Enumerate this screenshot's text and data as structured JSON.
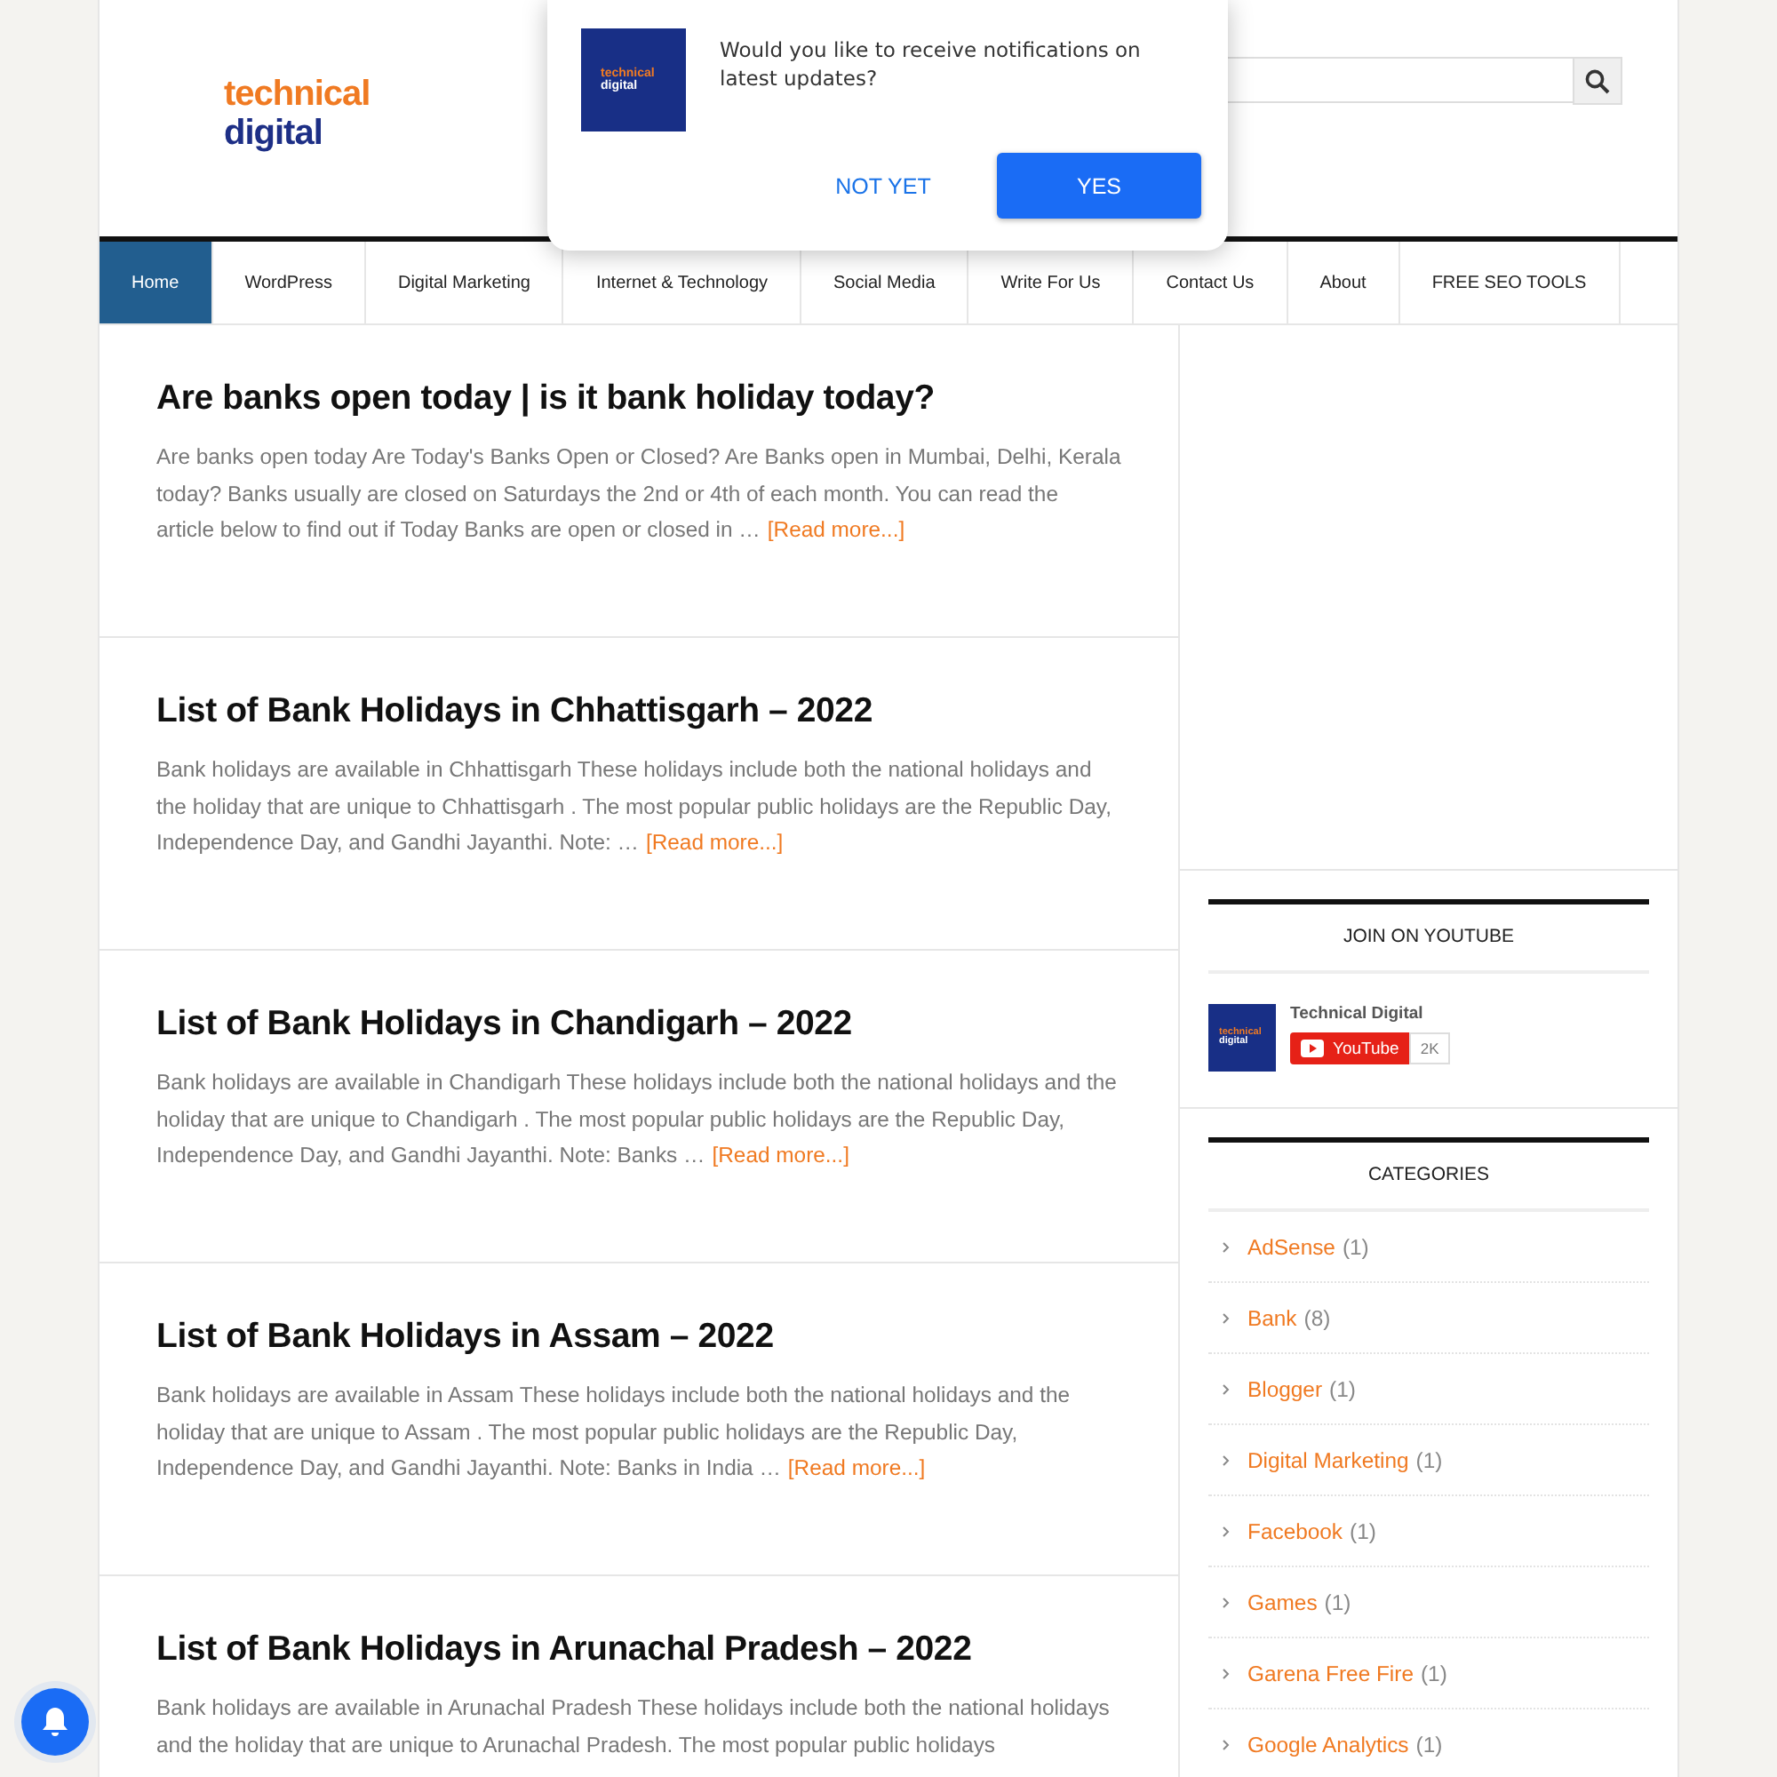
{
  "logo": {
    "line1": "technical",
    "line2": "digital"
  },
  "popup": {
    "logo_lines": [
      "technical",
      "digital"
    ],
    "message": "Would you like to receive notifications on latest updates?",
    "buttons": [
      {
        "label": "NOT YET",
        "kind": "text"
      },
      {
        "label": "YES",
        "kind": "primary"
      }
    ]
  },
  "nav": [
    {
      "label": "Home",
      "selected": true
    },
    {
      "label": "WordPress",
      "selected": false
    },
    {
      "label": "Digital Marketing",
      "selected": false
    },
    {
      "label": "Internet & Technology",
      "selected": false
    },
    {
      "label": "Social Media",
      "selected": false
    },
    {
      "label": "Write For Us",
      "selected": false
    },
    {
      "label": "Contact Us",
      "selected": false
    },
    {
      "label": "About",
      "selected": false
    },
    {
      "label": "FREE SEO TOOLS",
      "selected": false
    }
  ],
  "posts": [
    {
      "title": "Are banks open today | is it bank holiday today?",
      "excerpt": "Are banks open today Are Today's Banks Open or Closed? Are Banks open in Mumbai, Delhi, Kerala today? Banks usually are closed on Saturdays the 2nd or 4th of each month. You can read the article below to find out if Today Banks are open or closed in …",
      "read_more": "[Read more...]"
    },
    {
      "title": "List of Bank Holidays in Chhattisgarh – 2022",
      "excerpt": "Bank holidays are available in Chhattisgarh These holidays include both the national holidays and the holiday that are unique to Chhattisgarh . The most popular public holidays are the Republic Day, Independence Day, and Gandhi Jayanthi. Note: …",
      "read_more": "[Read more...]"
    },
    {
      "title": "List of Bank Holidays in Chandigarh – 2022",
      "excerpt": "Bank holidays are available in Chandigarh These holidays include both the national holidays and the holiday that are unique to Chandigarh . The most popular public holidays are the Republic Day, Independence Day, and Gandhi Jayanthi. Note: Banks …",
      "read_more": "[Read more...]"
    },
    {
      "title": "List of Bank Holidays in Assam – 2022",
      "excerpt": "Bank holidays are available in Assam These holidays include both the national holidays and the holiday that are unique to Assam . The most popular public holidays are the Republic Day, Independence Day, and Gandhi Jayanthi. Note: Banks in India …",
      "read_more": "[Read more...]"
    },
    {
      "title": "List of Bank Holidays in Arunachal Pradesh – 2022",
      "excerpt": "Bank holidays are available in Arunachal Pradesh These holidays include both the national holidays and the holiday that are unique to Arunachal Pradesh. The most popular public holidays"
    }
  ],
  "youtube_widget": {
    "title": "JOIN ON YOUTUBE",
    "avatar_lines": [
      "technical",
      "digital"
    ],
    "channel": "Technical Digital",
    "button": "YouTube",
    "count": "2K"
  },
  "categories_widget": {
    "title": "CATEGORIES",
    "items": [
      {
        "name": "AdSense",
        "count": "(1)"
      },
      {
        "name": "Bank",
        "count": "(8)"
      },
      {
        "name": "Blogger",
        "count": "(1)"
      },
      {
        "name": "Digital Marketing",
        "count": "(1)"
      },
      {
        "name": "Facebook",
        "count": "(1)"
      },
      {
        "name": "Games",
        "count": "(1)"
      },
      {
        "name": "Garena Free Fire",
        "count": "(1)"
      },
      {
        "name": "Google Analytics",
        "count": "(1)"
      }
    ]
  }
}
